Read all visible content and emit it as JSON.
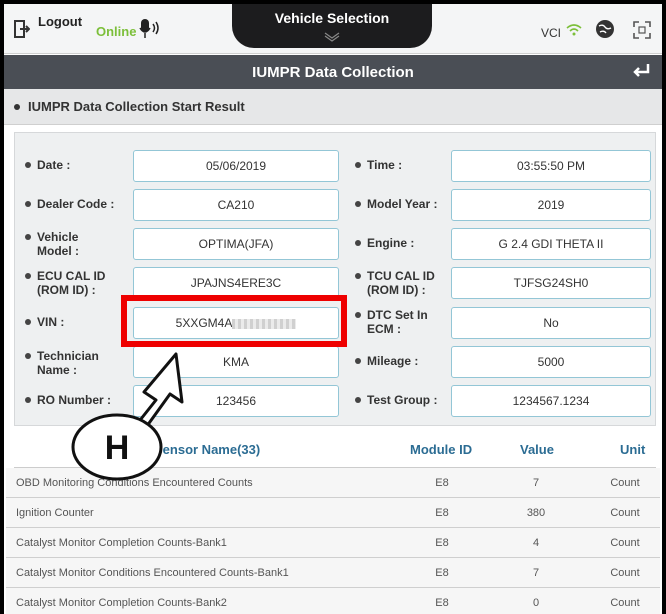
{
  "topbar": {
    "logout_label": "Logout",
    "status": "Online",
    "center_title": "Vehicle Selection",
    "vci_label": "VCI"
  },
  "title": "IUMPR Data Collection",
  "section_header": "IUMPR Data Collection Start Result",
  "info": {
    "date_label": "Date :",
    "date_value": "05/06/2019",
    "time_label": "Time :",
    "time_value": "03:55:50 PM",
    "dealer_label": "Dealer Code :",
    "dealer_value": "CA210",
    "model_year_label": "Model Year :",
    "model_year_value": "2019",
    "vehicle_model_label": "Vehicle Model :",
    "vehicle_model_value": "OPTIMA(JFA)",
    "engine_label": "Engine :",
    "engine_value": "G 2.4 GDI THETA II",
    "ecu_label": "ECU CAL ID (ROM ID) :",
    "ecu_value": "JPAJNS4ERE3C",
    "tcu_label": "TCU CAL ID (ROM ID) :",
    "tcu_value": "TJFSG24SH0",
    "vin_label": "VIN :",
    "vin_value": "5XXGM4A",
    "dtc_label": "DTC Set In ECM :",
    "dtc_value": "No",
    "tech_label": "Technician Name :",
    "tech_value": "KMA",
    "mileage_label": "Mileage :",
    "mileage_value": "5000",
    "ro_label": "RO Number :",
    "ro_value": "123456",
    "test_group_label": "Test Group :",
    "test_group_value": "1234567.1234"
  },
  "table": {
    "headers": {
      "name": "Sensor Name(33)",
      "module": "Module ID",
      "value": "Value",
      "unit": "Unit"
    },
    "rows": [
      {
        "name": "OBD Monitoring Conditions Encountered Counts",
        "module": "E8",
        "value": "7",
        "unit": "Count"
      },
      {
        "name": "Ignition Counter",
        "module": "E8",
        "value": "380",
        "unit": "Count"
      },
      {
        "name": "Catalyst Monitor Completion Counts-Bank1",
        "module": "E8",
        "value": "4",
        "unit": "Count"
      },
      {
        "name": "Catalyst Monitor Conditions Encountered Counts-Bank1",
        "module": "E8",
        "value": "7",
        "unit": "Count"
      },
      {
        "name": "Catalyst Monitor Completion Counts-Bank2",
        "module": "E8",
        "value": "0",
        "unit": "Count"
      }
    ]
  },
  "annotation": {
    "letter": "H",
    "color": "#e00000"
  },
  "colors": {
    "title_bar": "#4a4e55",
    "online": "#7cbf3a",
    "header_text": "#2b6c93",
    "field_border": "#93c6d6"
  }
}
